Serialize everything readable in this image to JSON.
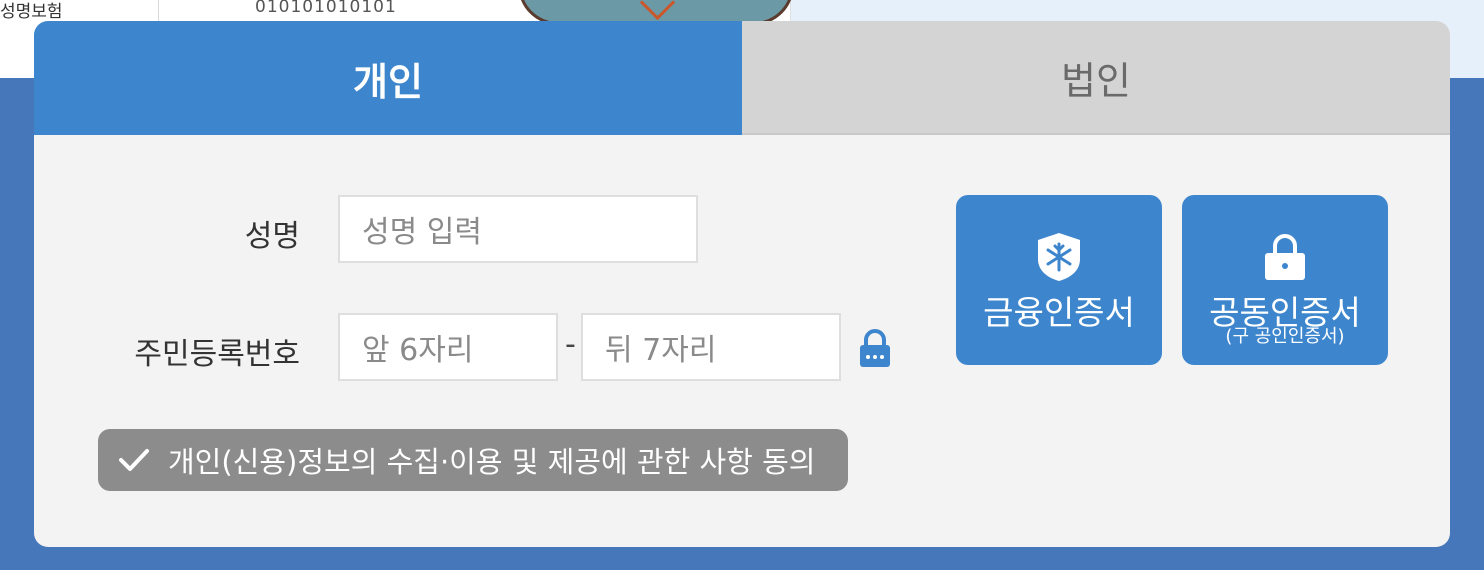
{
  "background": {
    "card_label": "성명보험",
    "card_number": "010101010101"
  },
  "tabs": [
    {
      "label": "개인",
      "active": true
    },
    {
      "label": "법인",
      "active": false
    }
  ],
  "form": {
    "name_label": "성명",
    "name_placeholder": "성명 입력",
    "rrn_label": "주민등록번호",
    "rrn_front_placeholder": "앞 6자리",
    "rrn_separator": "-",
    "rrn_back_placeholder": "뒤 7자리"
  },
  "cert_buttons": {
    "financial": {
      "label": "금융인증서",
      "icon": "shield-snowflake-icon"
    },
    "joint": {
      "label": "공동인증서",
      "sublabel": "(구 공인인증서)",
      "icon": "padlock-icon"
    }
  },
  "consent": {
    "label": "개인(신용)정보의 수집·이용 및 제공에 관한 사항 동의",
    "icon": "checkmark-icon"
  },
  "colors": {
    "primary": "#3d86cd",
    "page_bg": "#4677bb",
    "panel_bg": "#f3f3f3",
    "tab_inactive": "#d4d4d4",
    "consent_bg": "#8c8c8c"
  }
}
